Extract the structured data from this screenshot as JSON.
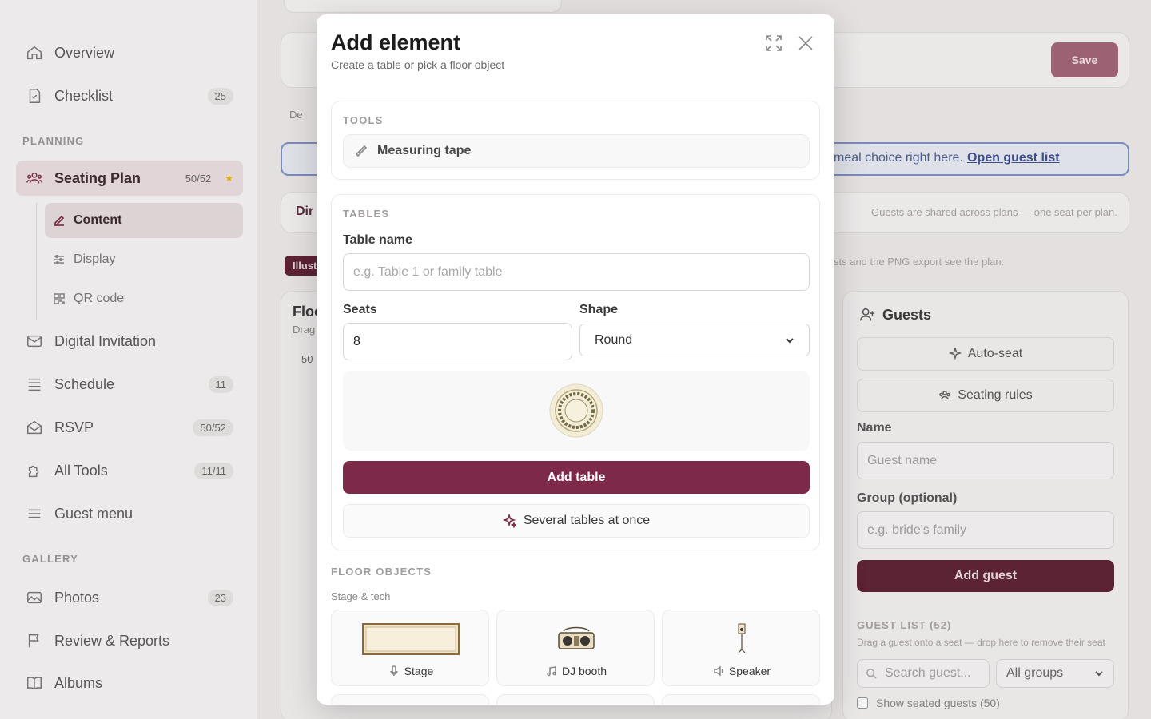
{
  "sidebar": {
    "items": [
      {
        "label": "Overview",
        "icon": "home-icon"
      },
      {
        "label": "Checklist",
        "icon": "checklist-icon",
        "badge": "25"
      },
      {
        "label": "Seating Plan",
        "icon": "people-icon",
        "badge": "50/52"
      },
      {
        "label": "Digital Invitation",
        "icon": "mail-icon"
      },
      {
        "label": "Schedule",
        "icon": "list-icon",
        "badge": "11"
      },
      {
        "label": "RSVP",
        "icon": "envelope-open-icon",
        "badge": "50/52"
      },
      {
        "label": "All Tools",
        "icon": "puzzle-icon",
        "badge": "11/11"
      },
      {
        "label": "Guest menu",
        "icon": "menu-icon"
      },
      {
        "label": "Photos",
        "icon": "image-icon",
        "badge": "23"
      },
      {
        "label": "Review & Reports",
        "icon": "flag-icon"
      },
      {
        "label": "Albums",
        "icon": "book-icon"
      }
    ],
    "sections": {
      "planning": "PLANNING",
      "gallery": "GALLERY"
    },
    "sub_items": [
      {
        "label": "Content",
        "icon": "edit-icon"
      },
      {
        "label": "Display",
        "icon": "sliders-icon"
      },
      {
        "label": "QR code",
        "icon": "qr-icon"
      }
    ]
  },
  "background": {
    "save_label": "Save",
    "banner_text": "meal choice right here.",
    "banner_link": "Open guest list",
    "shared_note": "Guests are shared across plans — one seat per plan.",
    "export_note": "sts and the PNG export see the plan.",
    "tab_fragment": "Dir",
    "illus_fragment": "Illust",
    "floor_fragment": "Floo",
    "drag_fragment": "Drag",
    "num_fragment": "50",
    "lang_fragment": "De",
    "guests": {
      "title": "Guests",
      "auto_seat": "Auto-seat",
      "seating_rules": "Seating rules",
      "name_label": "Name",
      "name_placeholder": "Guest name",
      "group_label": "Group (optional)",
      "group_placeholder": "e.g. bride's family",
      "add_guest": "Add guest",
      "list_title": "GUEST LIST (52)",
      "list_hint": "Drag a guest onto a seat — drop here to remove their seat",
      "search_placeholder": "Search guest...",
      "group_filter": "All groups",
      "show_seated": "Show seated guests (50)"
    }
  },
  "modal": {
    "title": "Add element",
    "subtitle": "Create a table or pick a floor object",
    "tools_label": "TOOLS",
    "measuring_tape": "Measuring tape",
    "tables_label": "TABLES",
    "table_name_label": "Table name",
    "table_name_placeholder": "e.g. Table 1 or family table",
    "seats_label": "Seats",
    "seats_value": "8",
    "shape_label": "Shape",
    "shape_value": "Round",
    "add_table": "Add table",
    "several_tables": "Several tables at once",
    "floor_objects_label": "FLOOR OBJECTS",
    "stage_tech_label": "Stage & tech",
    "objects": [
      {
        "label": "Stage",
        "icon": "microphone-icon"
      },
      {
        "label": "DJ booth",
        "icon": "music-note-icon"
      },
      {
        "label": "Speaker",
        "icon": "speaker-icon"
      }
    ]
  },
  "colors": {
    "accent": "#7d2a4a",
    "banner_border": "#7d92c7"
  }
}
